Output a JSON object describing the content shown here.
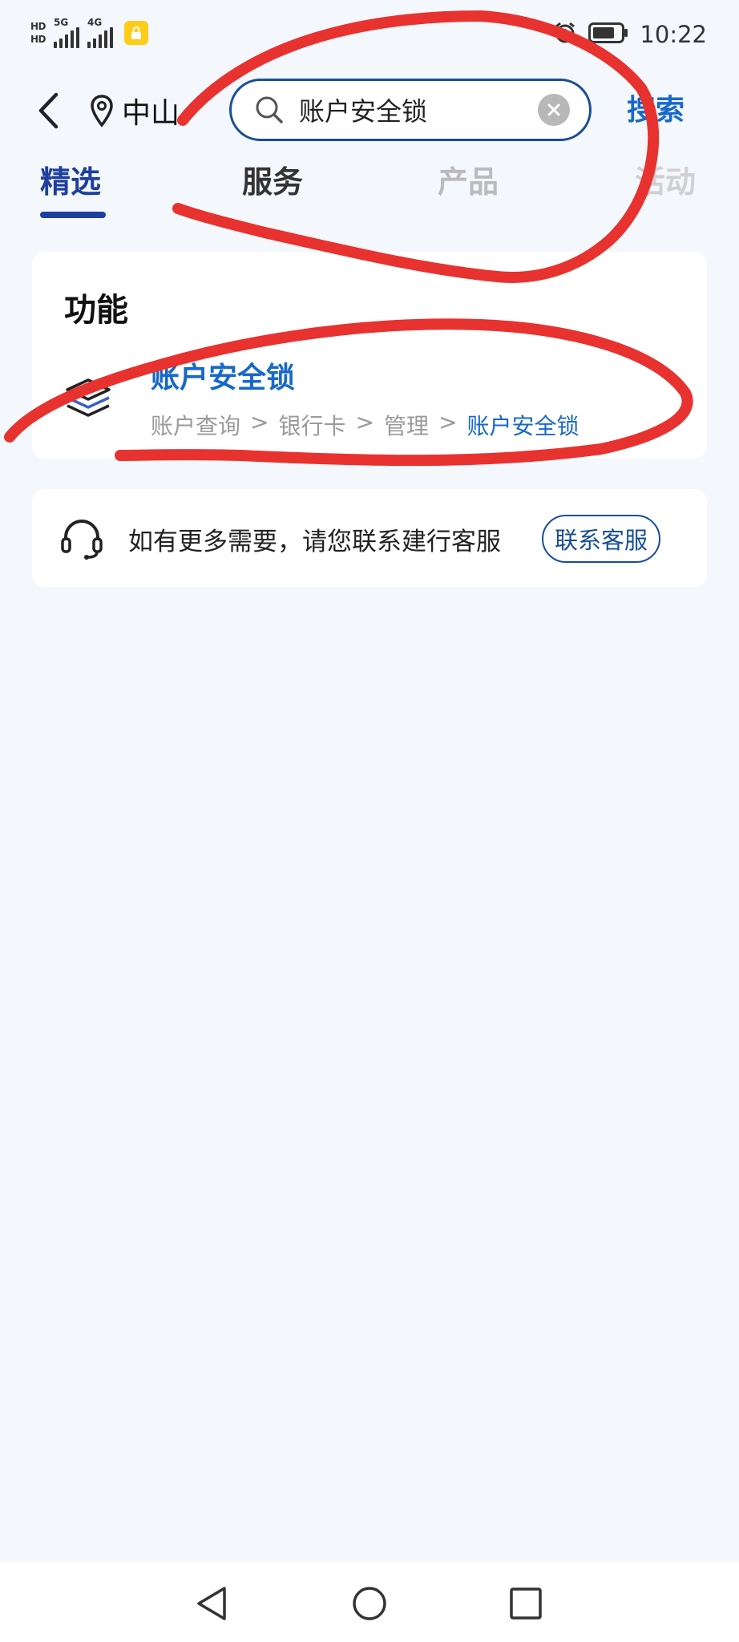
{
  "status_bar": {
    "hd_tags": [
      "HD",
      "HD"
    ],
    "network_1": "5G",
    "network_2": "4G",
    "time": "10:22"
  },
  "header": {
    "location": "中山",
    "search_value": "账户安全锁",
    "search_action": "搜索"
  },
  "tabs": [
    {
      "label": "精选",
      "active": true
    },
    {
      "label": "服务",
      "active": false
    },
    {
      "label": "产品",
      "active": false
    },
    {
      "label": "活动",
      "active": false
    }
  ],
  "function_section": {
    "title": "功能",
    "result": {
      "title": "账户安全锁",
      "breadcrumb": [
        "账户查询",
        ">",
        "银行卡",
        ">",
        "管理",
        ">",
        "账户安全锁"
      ]
    }
  },
  "help_card": {
    "text": "如有更多需要，请您联系建行客服",
    "button": "联系客服"
  },
  "colors": {
    "accent_blue": "#1769c9",
    "navy": "#1e3f9c",
    "annotation_red": "#e8322f",
    "background": "#f4f7fc"
  },
  "icons": [
    "back-arrow-icon",
    "location-pin-icon",
    "search-icon",
    "clear-icon",
    "layers-icon",
    "headset-icon",
    "alarm-icon",
    "battery-icon",
    "lock-icon"
  ]
}
